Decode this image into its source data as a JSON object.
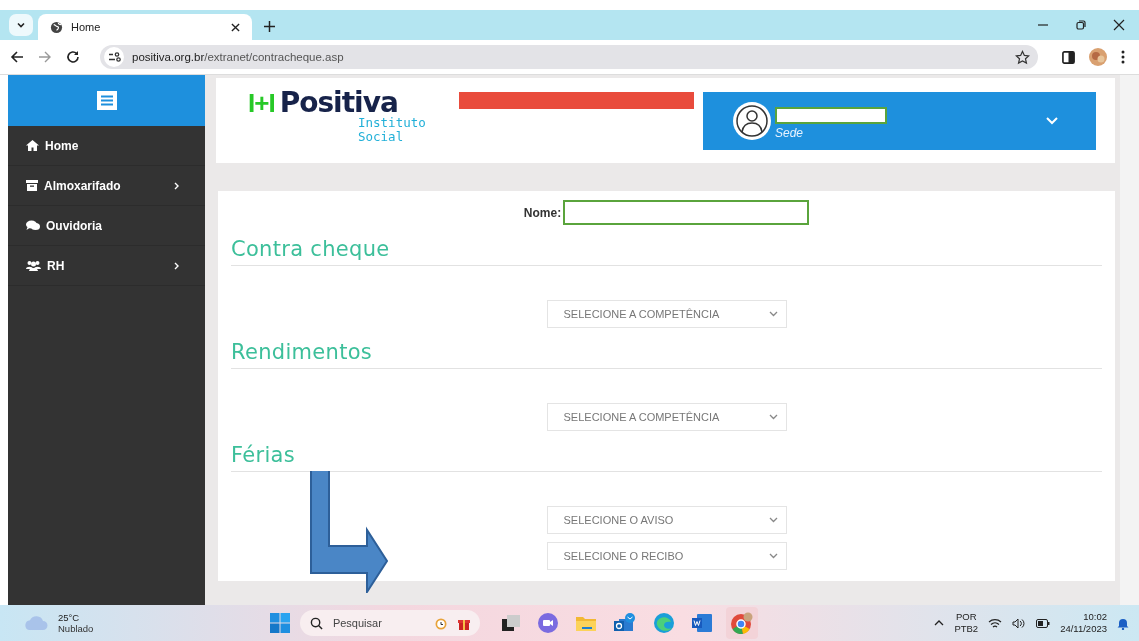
{
  "browser": {
    "tabs": [
      {
        "title": "Home",
        "selected": true
      }
    ],
    "url_host": "positiva.org.br",
    "url_path": "/extranet/contracheque.asp"
  },
  "sidebar": {
    "items": [
      {
        "label": "Home",
        "expandable": false
      },
      {
        "label": "Almoxarifado",
        "expandable": true
      },
      {
        "label": "Ouvidoria",
        "expandable": false
      },
      {
        "label": "RH",
        "expandable": true
      }
    ]
  },
  "header": {
    "logo": {
      "mark": "I+I",
      "name": "Positiva",
      "line1": "Instituto",
      "line2": "Social"
    },
    "user": {
      "unit": "Sede"
    }
  },
  "form": {
    "name_label": "Nome:",
    "sections": [
      {
        "title": "Contra cheque",
        "selects": [
          "SELECIONE A COMPETÊNCIA"
        ]
      },
      {
        "title": "Rendimentos",
        "selects": [
          "SELECIONE A COMPETÊNCIA"
        ]
      },
      {
        "title": "Férias",
        "selects": [
          "SELECIONE O AVISO",
          "SELECIONE O RECIBO"
        ]
      }
    ]
  },
  "taskbar": {
    "temperature": "25°C",
    "weather": "Nublado",
    "search_placeholder": "Pesquisar",
    "language": "POR",
    "layout": "PTB2",
    "time": "10:02",
    "date": "24/11/2023"
  }
}
